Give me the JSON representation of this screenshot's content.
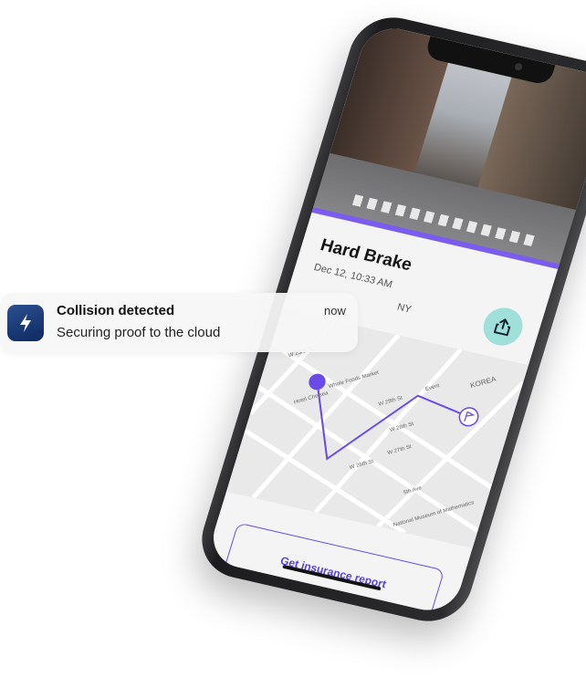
{
  "notification": {
    "title": "Collision detected",
    "body": "Securing proof to the cloud",
    "time": "now",
    "icon": "bolt-app-icon"
  },
  "event": {
    "title": "Hard Brake",
    "time": "Dec 12, 10:33 AM",
    "location": "NY",
    "share_icon": "share-icon"
  },
  "map": {
    "labels": [
      "W 23rd St",
      "Whole Foods Market",
      "Hotel Chelsea",
      "W 29th St",
      "W 28th St",
      "W 27th St",
      "W 26th St",
      "Event",
      "KOREA",
      "5th Ave",
      "National Museum of Mathematics"
    ]
  },
  "report_button": {
    "label": "Get insurance report"
  },
  "colors": {
    "accent": "#6a4be8",
    "share_bg": "#9fe0da",
    "notif_icon": "#1b3a75"
  }
}
